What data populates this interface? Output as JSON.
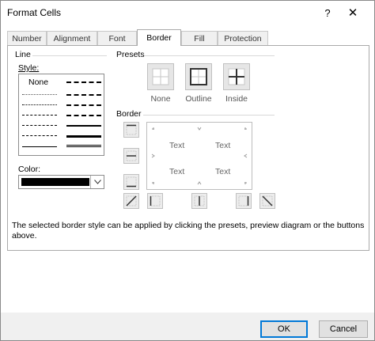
{
  "window": {
    "title": "Format Cells",
    "help_glyph": "?",
    "close_glyph": "✕"
  },
  "tabs": [
    {
      "label": "Number",
      "active": false
    },
    {
      "label": "Alignment",
      "active": false
    },
    {
      "label": "Font",
      "active": false
    },
    {
      "label": "Border",
      "active": true
    },
    {
      "label": "Fill",
      "active": false
    },
    {
      "label": "Protection",
      "active": false
    }
  ],
  "line": {
    "group_label": "Line",
    "style_label": "Style:",
    "none_label": "None",
    "color_label": "Color:",
    "color_value": "#000000"
  },
  "presets": {
    "group_label": "Presets",
    "items": [
      {
        "label": "None",
        "icon": "preset-none-icon"
      },
      {
        "label": "Outline",
        "icon": "preset-outline-icon"
      },
      {
        "label": "Inside",
        "icon": "preset-inside-icon"
      }
    ]
  },
  "border": {
    "group_label": "Border",
    "preview_texts": [
      "Text",
      "Text",
      "Text",
      "Text"
    ],
    "buttons": [
      "border-top-icon",
      "border-inside-horizontal-icon",
      "border-bottom-icon",
      "border-diagonal-up-icon",
      "border-left-icon",
      "border-inside-vertical-icon",
      "border-right-icon",
      "border-diagonal-down-icon"
    ]
  },
  "description": "The selected border style can be applied by clicking the presets, preview diagram or the buttons above.",
  "footer": {
    "ok_label": "OK",
    "cancel_label": "Cancel"
  },
  "colors": {
    "accent": "#0078d7",
    "panel_border": "#aaaaaa",
    "button_bg": "#e1e1e1"
  }
}
